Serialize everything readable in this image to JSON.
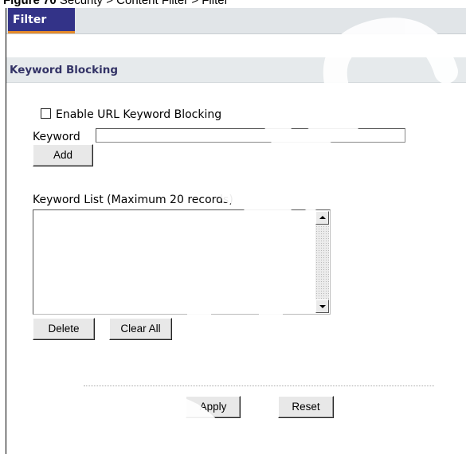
{
  "caption": {
    "figure_label": "Figure 70",
    "path": "Security > Content Filter > Filter"
  },
  "tabs": [
    {
      "label": "Filter",
      "active": true
    }
  ],
  "section": {
    "title": "Keyword Blocking"
  },
  "enable": {
    "label": "Enable URL Keyword Blocking",
    "checked": false
  },
  "keyword": {
    "label": "Keyword",
    "value": ""
  },
  "buttons": {
    "add": "Add",
    "delete": "Delete",
    "clear_all": "Clear All",
    "apply": "Apply",
    "reset": "Reset"
  },
  "keyword_list": {
    "label": "Keyword List (Maximum 20 records)",
    "items": []
  },
  "colors": {
    "tab_background": "#333388",
    "tab_accent": "#e48a2a",
    "section_header_text": "#333366",
    "section_header_background": "#e6eaec"
  }
}
